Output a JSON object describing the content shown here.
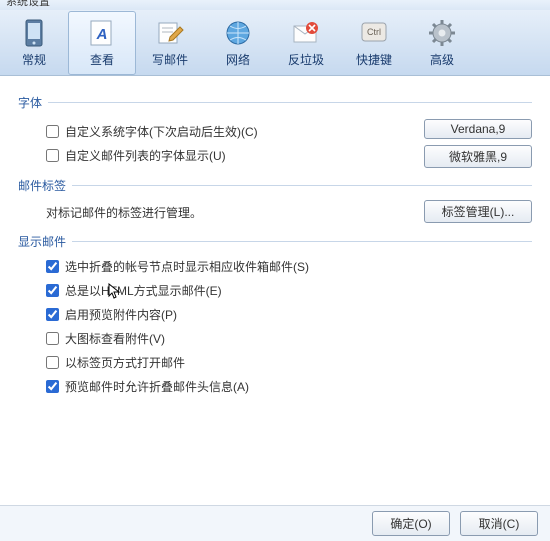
{
  "title": "系统设置",
  "toolbar": [
    {
      "id": "general",
      "label": "常规"
    },
    {
      "id": "view",
      "label": "查看"
    },
    {
      "id": "compose",
      "label": "写邮件"
    },
    {
      "id": "network",
      "label": "网络"
    },
    {
      "id": "antispam",
      "label": "反垃圾"
    },
    {
      "id": "shortcut",
      "label": "快捷键"
    },
    {
      "id": "advanced",
      "label": "高级"
    }
  ],
  "sections": {
    "font": {
      "title": "字体",
      "chk1": "自定义系统字体(下次启动后生效)(C)",
      "chk2": "自定义邮件列表的字体显示(U)",
      "btn1": "Verdana,9",
      "btn2": "微软雅黑,9"
    },
    "tags": {
      "title": "邮件标签",
      "note": "对标记邮件的标签进行管理。",
      "btn": "标签管理(L)..."
    },
    "display": {
      "title": "显示邮件",
      "c1": "选中折叠的帐号节点时显示相应收件箱邮件(S)",
      "c2": "总是以HTML方式显示邮件(E)",
      "c3": "启用预览附件内容(P)",
      "c4": "大图标查看附件(V)",
      "c5": "以标签页方式打开邮件",
      "c6": "预览邮件时允许折叠邮件头信息(A)"
    }
  },
  "buttons": {
    "ok": "确定(O)",
    "cancel": "取消(C)"
  }
}
